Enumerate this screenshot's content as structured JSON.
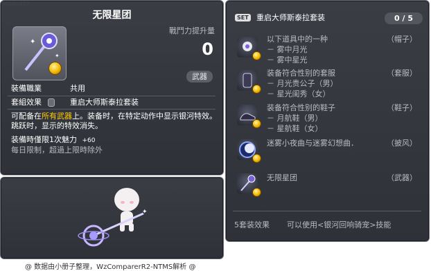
{
  "watermark_id": "01702857",
  "item": {
    "name": "无限星团",
    "power_label": "戰鬥力提升量",
    "power_value": "0",
    "category": "武器",
    "job_label": "裝備職業",
    "job_value": "共用",
    "set_label": "套組效果",
    "set_value": "重启大师斯泰拉套装",
    "desc_pre": "可配备在",
    "desc_highlight": "所有武器",
    "desc_post": "上。装备时，在特定动作中显示银河特效。跳跃时，显示的特效消失。",
    "limit_label": "装備時僅限1次魅力",
    "limit_value": "+60",
    "reset_note": "每日限制，超過上限時除外"
  },
  "set_panel": {
    "badge": "SET",
    "title": "重启大师斯泰拉套装",
    "count": "0 / 5",
    "items": [
      {
        "name": "以下道具中的一种",
        "subs": [
          "－ 雾中月光",
          "－ 雾中星光"
        ],
        "slot": "（帽子）",
        "icon": "hat-icon"
      },
      {
        "name": "装备符合性别的套服",
        "subs": [
          "－ 月光贵公子（男）",
          "－ 星光闺秀（女）"
        ],
        "slot": "（套服）",
        "icon": "outfit-icon"
      },
      {
        "name": "装备符合性别的鞋子",
        "subs": [
          "－ 月航鞋（男）",
          "－ 星航鞋（女）"
        ],
        "slot": "（鞋子）",
        "icon": "shoes-icon"
      },
      {
        "name": "迷雾小夜曲与迷雾幻想曲．",
        "subs": [],
        "slot": "（披风）",
        "icon": "cape-icon"
      },
      {
        "name": "无限星团",
        "subs": [],
        "slot": "（武器）",
        "icon": "weapon-icon"
      }
    ],
    "bonus_label": "5套装效果",
    "bonus_value": "可以使用<银河回响骑宠>技能"
  },
  "footer": "@ 数据由小册子整理，WzComparerR2-NTMS解析 @",
  "colors": {
    "highlight": "#ffcc00",
    "panel": "#34363d",
    "muted": "#a7a9ae"
  }
}
